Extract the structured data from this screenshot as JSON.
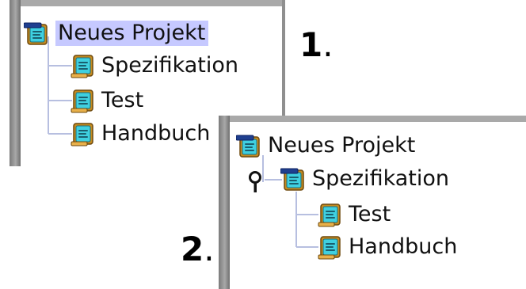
{
  "step1": {
    "number": "1",
    "tree": {
      "root": {
        "label": "Neues Projekt",
        "selected": true,
        "icon": "project-folder-icon"
      },
      "children": [
        {
          "label": "Spezifikation",
          "icon": "document-folder-icon"
        },
        {
          "label": "Test",
          "icon": "document-folder-icon"
        },
        {
          "label": "Handbuch",
          "icon": "document-folder-icon"
        }
      ]
    }
  },
  "step2": {
    "number": "2",
    "tree": {
      "root": {
        "label": "Neues Projekt",
        "icon": "project-folder-icon"
      },
      "branch": {
        "label": "Spezifikation",
        "expanded": true,
        "toggle_icon": "tree-expander-icon",
        "icon": "project-folder-icon",
        "children": [
          {
            "label": "Test",
            "icon": "document-folder-icon"
          },
          {
            "label": "Handbuch",
            "icon": "document-folder-icon"
          }
        ]
      }
    }
  },
  "colors": {
    "selection": "#c6c9ff",
    "tree_line": "#b7bfe0",
    "frame": "#8f8f8f",
    "icon_body": "#3fd0e0",
    "icon_frame": "#c48a1e",
    "icon_bar": "#1f3f8f"
  }
}
